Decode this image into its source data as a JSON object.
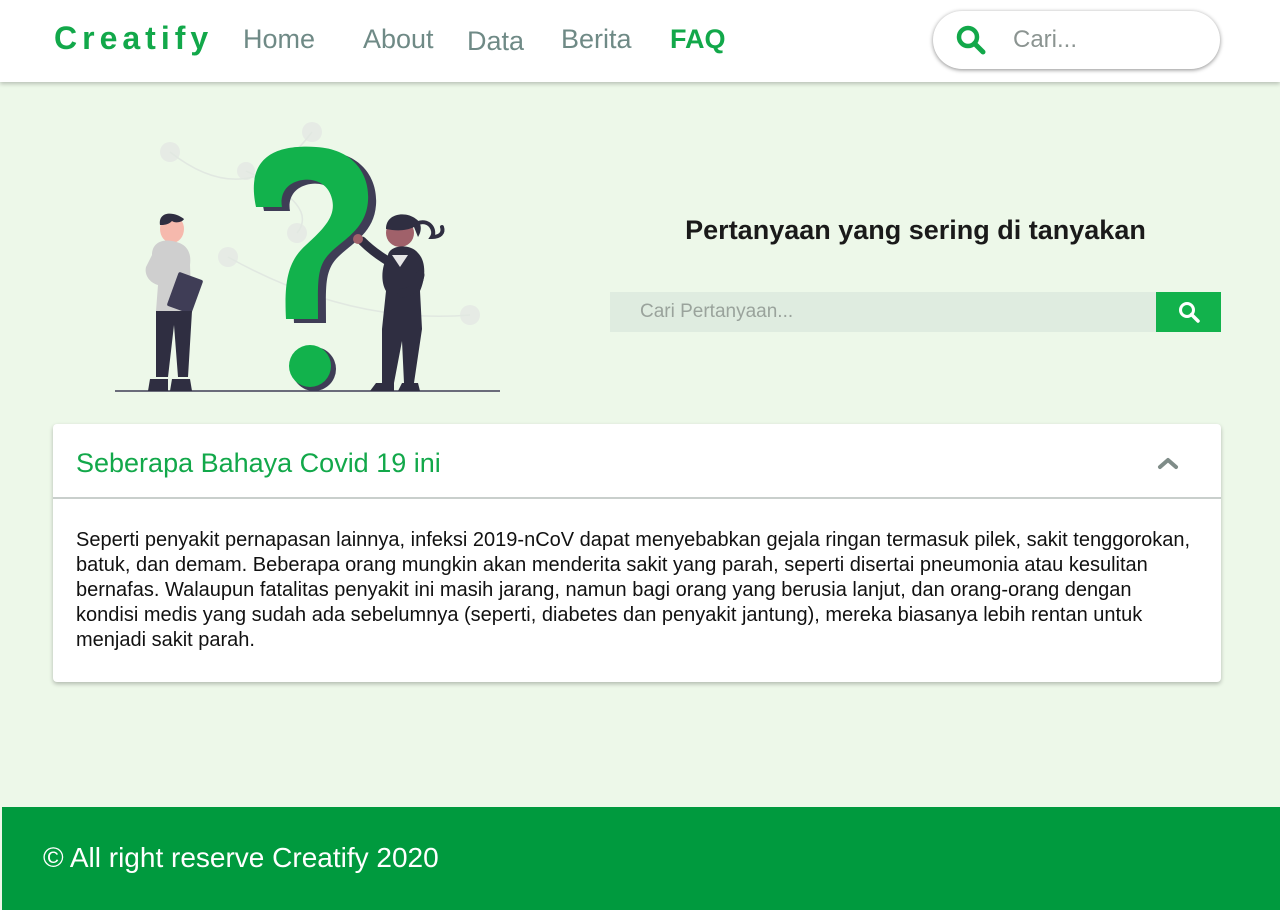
{
  "nav": {
    "brand": "Creatify",
    "links": [
      {
        "label": "Home"
      },
      {
        "label": "About"
      },
      {
        "label": "Data"
      },
      {
        "label": "Berita"
      },
      {
        "label": "FAQ",
        "active": true
      }
    ],
    "search_placeholder": "Cari..."
  },
  "hero": {
    "title": "Pertanyaan yang sering di tanyakan",
    "search_placeholder": "Cari Pertanyaan..."
  },
  "faq": [
    {
      "question": "Seberapa Bahaya Covid 19 ini",
      "answer": "Seperti penyakit pernapasan lainnya, infeksi 2019-nCoV dapat menyebabkan gejala ringan termasuk pilek, sakit tenggorokan, batuk, dan demam. Beberapa orang mungkin akan menderita sakit yang parah, seperti disertai pneumonia atau kesulitan bernafas. Walaupun fatalitas penyakit ini masih jarang, namun bagi orang yang berusia lanjut, dan orang-orang dengan kondisi medis yang sudah ada sebelumnya (seperti, diabetes dan penyakit jantung), mereka biasanya lebih rentan untuk menjadi sakit parah.",
      "expanded": true
    }
  ],
  "footer": {
    "text": "© All right reserve Creatify 2020"
  },
  "colors": {
    "brand_green": "#12a84a",
    "footer_green": "#009a3e",
    "page_background": "#edf8e9",
    "nav_link_gray": "#6f8a86"
  },
  "icons": {
    "nav_search": "search-icon",
    "faq_search": "search-icon",
    "faq_toggle": "chevron-up-icon",
    "hero_image": "question-mark-illustration"
  }
}
